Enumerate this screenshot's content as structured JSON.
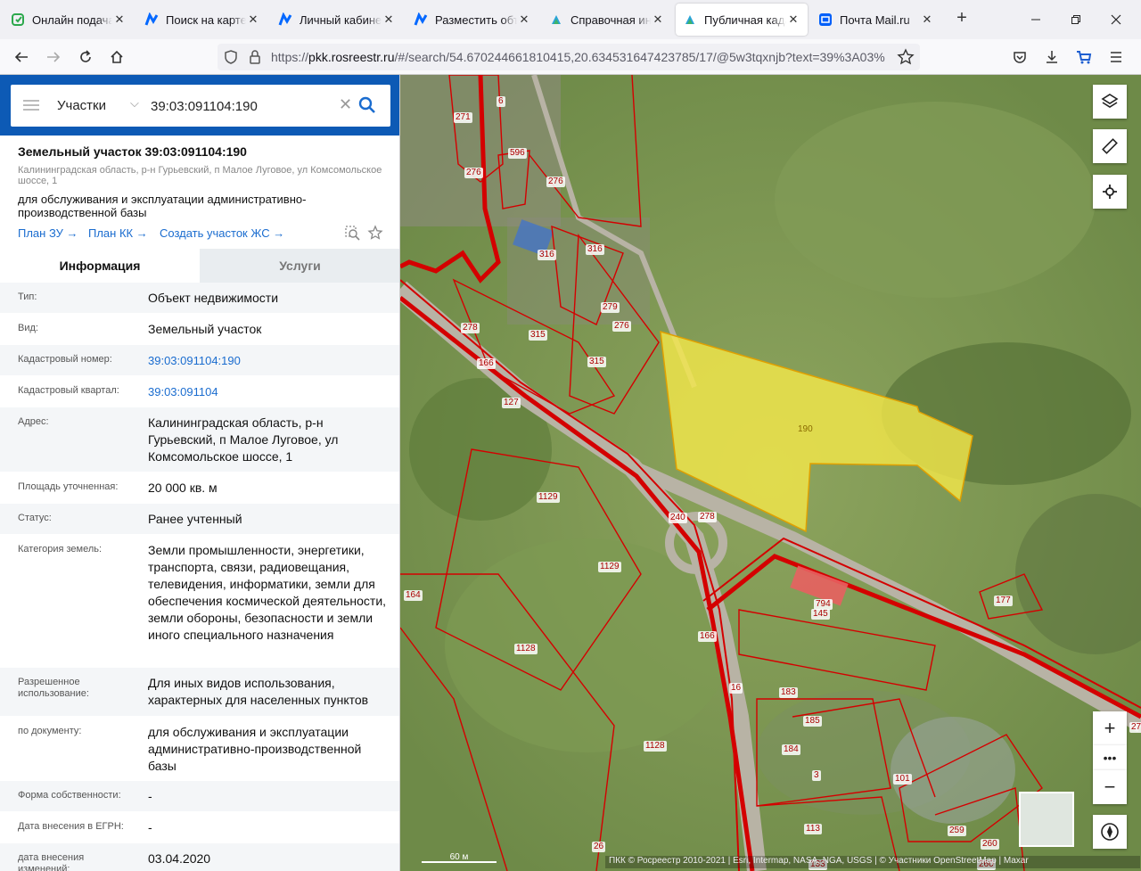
{
  "browser": {
    "tabs": [
      {
        "label": "Онлайн подача заявления",
        "icon": "gosuslugi-icon"
      },
      {
        "label": "Поиск на карте Циан",
        "icon": "cian-icon"
      },
      {
        "label": "Личный кабинет",
        "icon": "cian-icon"
      },
      {
        "label": "Разместить объявление",
        "icon": "cian-icon"
      },
      {
        "label": "Справочная информация",
        "icon": "rosreestr-icon"
      },
      {
        "label": "Публичная кадастровая карта",
        "icon": "rosreestr-icon",
        "active": true
      },
      {
        "label": "Почта Mail.ru",
        "icon": "mail-icon"
      }
    ],
    "url_host": "pkk.rosreestr.ru",
    "url_prefix": "https://",
    "url_rest": "/#/search/54.670244661810415,20.634531647423785/17/@5w3tqxnjb?text=39%3A03%"
  },
  "search": {
    "type_label": "Участки",
    "query": "39:03:091104:190"
  },
  "object": {
    "title": "Земельный участок 39:03:091104:190",
    "address": "Калининградская область, р-н Гурьевский, п Малое Луговое, ул Комсомольское шоссе, 1",
    "usage": "для обслуживания и эксплуатации административно-производственной базы",
    "links": [
      "План ЗУ",
      "План КК",
      "Создать участок ЖС"
    ]
  },
  "info_tabs": [
    "Информация",
    "Услуги"
  ],
  "rows": [
    {
      "label": "Тип:",
      "value": "Объект недвижимости"
    },
    {
      "label": "Вид:",
      "value": "Земельный участок"
    },
    {
      "label": "Кадастровый номер:",
      "value": "39:03:091104:190",
      "link": true
    },
    {
      "label": "Кадастровый квартал:",
      "value": "39:03:091104",
      "link": true
    },
    {
      "label": "Адрес:",
      "value": "Калининградская область, р-н Гурьевский, п Малое Луговое, ул Комсомольское шоссе, 1"
    },
    {
      "label": "Площадь уточненная:",
      "value": "20 000 кв. м"
    },
    {
      "label": "Статус:",
      "value": "Ранее учтенный"
    },
    {
      "label": "Категория земель:",
      "value": "Земли промышленности, энергетики, транспорта, связи, радиовещания, телевидения, информатики, земли для обеспечения космической деятельности, земли обороны, безопасности и земли иного специального назначения"
    },
    {
      "label": "Разрешенное использование:",
      "value": "Для иных видов использования, характерных для населенных пунктов"
    },
    {
      "label": "по документу:",
      "value": "для обслуживания и эксплуатации административно-производственной базы"
    },
    {
      "label": "Форма собственности:",
      "value": "-"
    },
    {
      "label": "Дата внесения в ЕГРН:",
      "value": "-"
    },
    {
      "label": "дата внесения изменений:",
      "value": "03.04.2020"
    }
  ],
  "map": {
    "selected_parcel": "190",
    "parcel_labels": [
      "271",
      "6",
      "276",
      "596",
      "276",
      "316",
      "316",
      "279",
      "276",
      "278",
      "315",
      "315",
      "166",
      "127",
      "1129",
      "1129",
      "240",
      "278",
      "164",
      "1128",
      "166",
      "16",
      "794",
      "145",
      "177",
      "183",
      "185",
      "184",
      "3",
      "101",
      "1128",
      "113",
      "259",
      "260",
      "26",
      "133",
      "260",
      "27"
    ],
    "scale_label": "60 м",
    "attribution": "ПКК © Росреестр 2010-2021 | Esri, Intermap, NASA, NGA, USGS | © Участники OpenStreetMap | Maxar",
    "colors": {
      "selected_fill": "#f5e84a",
      "parcel_border": "#d40000"
    }
  }
}
